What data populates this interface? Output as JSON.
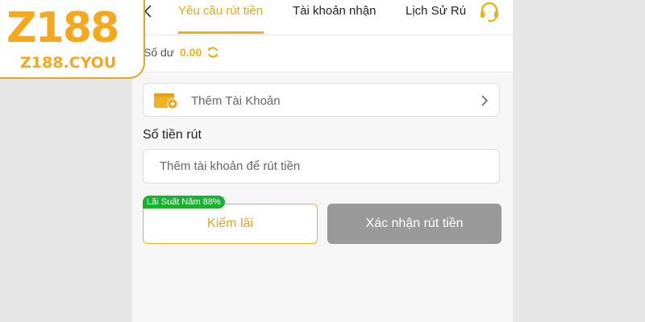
{
  "brand": {
    "logo_text": "Z188",
    "logo_domain": "Z188.CYOU",
    "accent": "#e8b21a",
    "logo_color": "#f5a81d"
  },
  "tabs": [
    {
      "label": "Yêu cầu rút tiền",
      "active": true
    },
    {
      "label": "Tài khoản nhận",
      "active": false
    },
    {
      "label": "Lịch Sử Rú",
      "active": false
    }
  ],
  "icons": {
    "back": "chevron-left-icon",
    "support": "headset-icon",
    "refresh": "refresh-icon",
    "wallet": "wallet-add-icon",
    "chevron": "chevron-right-icon"
  },
  "balance": {
    "label": "Số dư",
    "value": "0.00"
  },
  "add_account": {
    "label": "Thêm Tài Khoản"
  },
  "amount": {
    "label": "Số tiền rút",
    "placeholder": "Thêm tài khoản để rút tiền",
    "value": ""
  },
  "earn": {
    "button_label": "Kiếm lãi",
    "badge": "Lãi Suất Năm 88%",
    "badge_color": "#19b22f"
  },
  "confirm": {
    "button_label": "Xác nhận rút tiền",
    "disabled_color": "#999999"
  }
}
